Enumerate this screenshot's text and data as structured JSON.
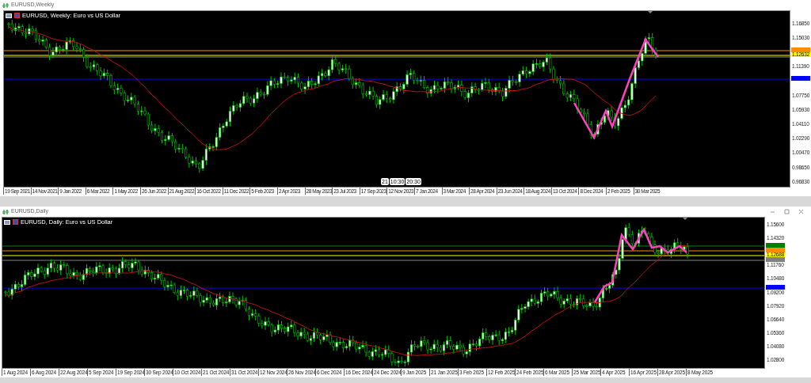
{
  "windows": [
    {
      "title": "EURUSD,Weekly",
      "legend": "EURUSD, Weekly:  Euro vs US Dollar",
      "show_controls": false,
      "price_labels": [
        "1.16850",
        "1.15030",
        "1.11390",
        "1.07750",
        "1.05930",
        "1.04110",
        "1.02290",
        "1.00470",
        "0.98650",
        "0.96830"
      ],
      "level_tags": [
        {
          "color": "#ff8c00"
        },
        {
          "text": "1.12632",
          "color": "#ffff00"
        },
        {
          "color": "#0000ff"
        }
      ],
      "time_tags": [
        "21",
        "10:30",
        "20:30"
      ],
      "date_labels": [
        "19 Sep 2021",
        "14 Nov 2021",
        "9 Jan 2022",
        "6 Mar 2022",
        "1 May 2022",
        "26 Jun 2022",
        "21 Aug 2022",
        "16 Oct 2022",
        "11 Dec 2022",
        "5 Feb 2023",
        "2 Apr 2023",
        "28 May 2023",
        "23 Jul 2023",
        "17 Sep 2023",
        "12 Nov 2023",
        "7 Jan 2024",
        "3 Mar 2024",
        "28 Apr 2024",
        "23 Jun 2024",
        "18 Aug 2024",
        "13 Oct 2024",
        "8 Dec 2024",
        "2 Feb 2025",
        "30 Mar 2025"
      ]
    },
    {
      "title": "EURUSD,Daily",
      "legend": "EURUSD, Daily:  Euro vs US Dollar",
      "show_controls": true,
      "price_labels": [
        "1.15600",
        "1.14320",
        "1.11760",
        "1.10480",
        "1.09200",
        "1.07920",
        "1.06640",
        "1.05360",
        "1.04080",
        "1.02800"
      ],
      "level_tags": [
        {
          "color": "#008000"
        },
        {
          "color": "#ff8c00"
        },
        {
          "text": "1.12688",
          "color": "#ffff00"
        },
        {
          "color": "#808080"
        },
        {
          "color": "#0000ff"
        }
      ],
      "date_labels": [
        "1 Aug 2024",
        "6 Aug 2024",
        "22 Aug 2024",
        "5 Sep 2024",
        "19 Sep 2024",
        "30 Sep 2024",
        "10 Oct 2024",
        "21 Oct 2024",
        "31 Oct 2024",
        "12 Nov 2024",
        "26 Nov 2024",
        "6 Dec 2024",
        "16 Dec 2024",
        "24 Dec 2024",
        "9 Jan 2025",
        "21 Jan 2025",
        "3 Feb 2025",
        "12 Feb 2025",
        "24 Feb 2025",
        "6 Mar 2025",
        "25 Mar 2025",
        "4 Apr 2025",
        "16 Apr 2025",
        "28 Apr 2025",
        "8 May 2025"
      ]
    }
  ]
}
